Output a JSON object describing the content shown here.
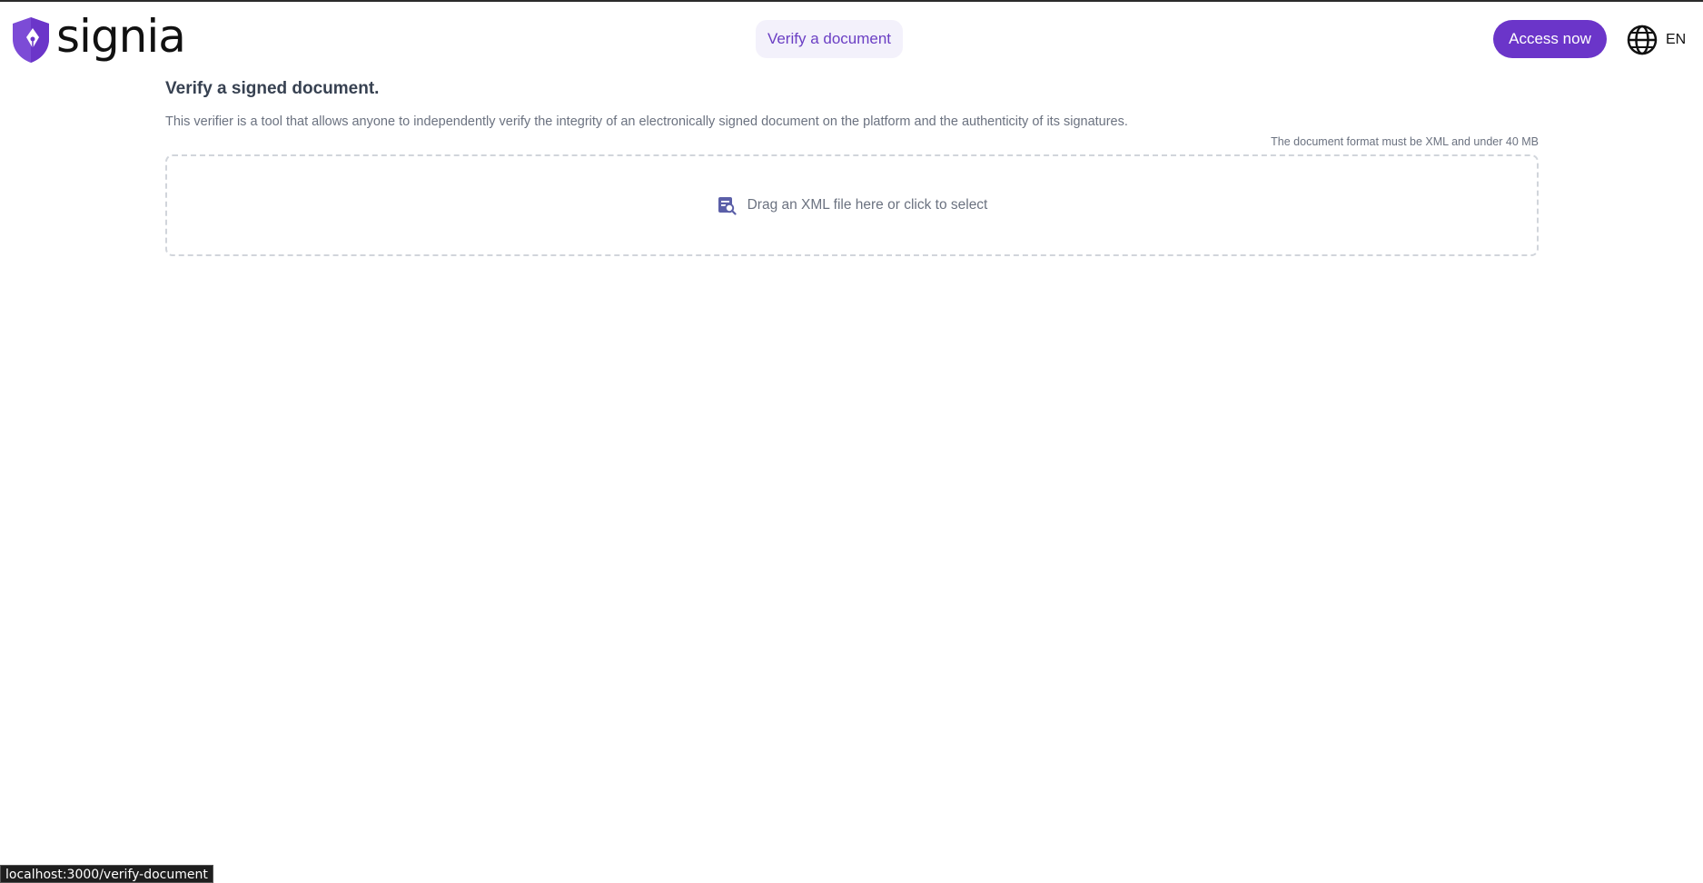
{
  "header": {
    "logo_text": "signia",
    "nav_verify_label": "Verify a document",
    "access_label": "Access now",
    "language": "EN"
  },
  "main": {
    "title": "Verify a signed document.",
    "description": "This verifier is a tool that allows anyone to independently verify the integrity of an electronically signed document on the platform and the authenticity of its signatures.",
    "format_note": "The document format must be XML and under 40 MB",
    "dropzone_text": "Drag an XML file here or click to select"
  },
  "status_bar": {
    "url": "localhost:3000/verify-document"
  },
  "colors": {
    "brand": "#6b35c9",
    "brand_light": "#f3f1fb",
    "icon": "#5b5fa8"
  },
  "icons": {
    "logo": "shield-pen-icon",
    "language": "globe-icon",
    "dropzone": "document-search-icon"
  }
}
